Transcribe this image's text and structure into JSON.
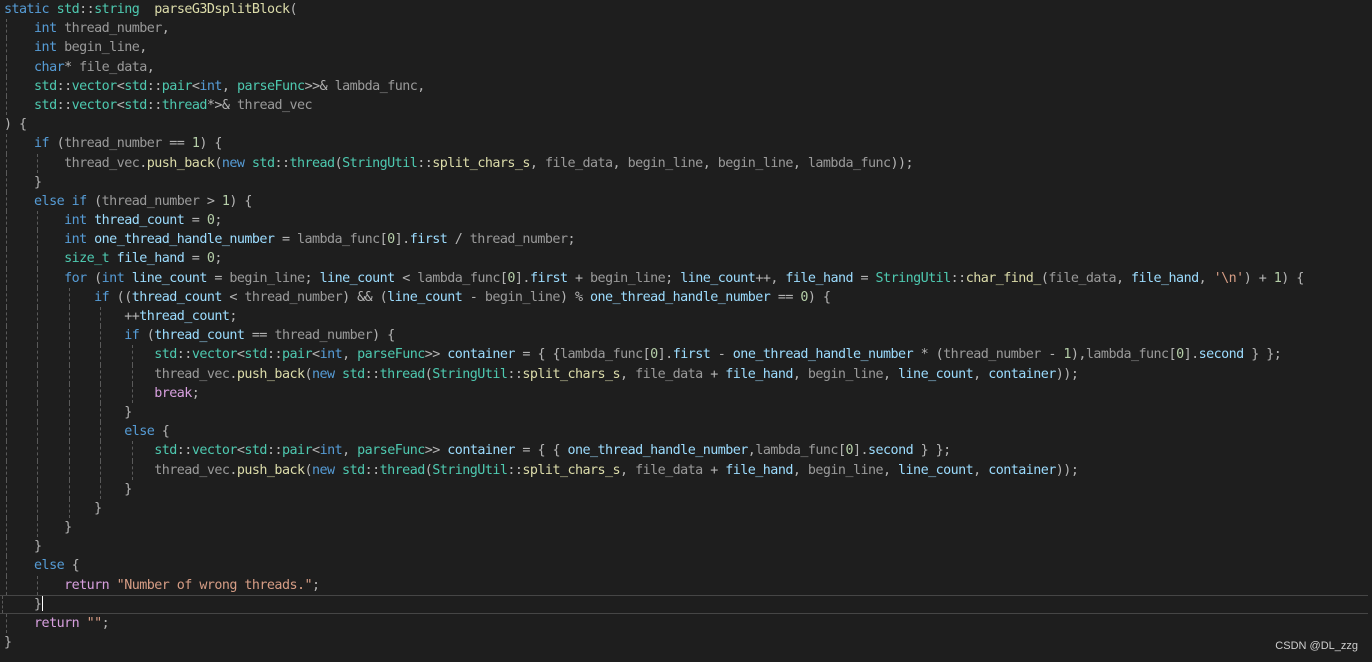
{
  "editor": {
    "theme": {
      "background": "#1e1e1e",
      "keyword": "#569cd6",
      "type": "#4ec9b0",
      "function": "#dcdcaa",
      "parameter": "#9a9a9a",
      "string": "#d69d85"
    },
    "cursor_line": 32
  },
  "code_lines": [
    [
      [
        "k",
        "static"
      ],
      [
        "",
        ""
      ],
      [
        "t",
        " std"
      ],
      [
        "o",
        "::"
      ],
      [
        "t",
        "string"
      ],
      [
        "",
        "  "
      ],
      [
        "f",
        "parseG3DsplitBlock"
      ],
      [
        "o",
        "("
      ]
    ],
    [
      [
        "",
        ""
      ],
      [
        "k",
        "    int"
      ],
      [
        "p",
        " thread_number"
      ],
      [
        "o",
        ","
      ]
    ],
    [
      [
        "k",
        "    int"
      ],
      [
        "p",
        " begin_line"
      ],
      [
        "o",
        ","
      ]
    ],
    [
      [
        "k",
        "    char"
      ],
      [
        "o",
        "*"
      ],
      [
        "p",
        " file_data"
      ],
      [
        "o",
        ","
      ]
    ],
    [
      [
        "t",
        "    std"
      ],
      [
        "o",
        "::"
      ],
      [
        "t",
        "vector"
      ],
      [
        "o",
        "<"
      ],
      [
        "t",
        "std"
      ],
      [
        "o",
        "::"
      ],
      [
        "t",
        "pair"
      ],
      [
        "o",
        "<"
      ],
      [
        "k",
        "int"
      ],
      [
        "o",
        ", "
      ],
      [
        "t",
        "parseFunc"
      ],
      [
        "o",
        ">>& "
      ],
      [
        "p",
        "lambda_func"
      ],
      [
        "o",
        ","
      ]
    ],
    [
      [
        "t",
        "    std"
      ],
      [
        "o",
        "::"
      ],
      [
        "t",
        "vector"
      ],
      [
        "o",
        "<"
      ],
      [
        "t",
        "std"
      ],
      [
        "o",
        "::"
      ],
      [
        "t",
        "thread"
      ],
      [
        "o",
        "*>& "
      ],
      [
        "p",
        "thread_vec"
      ]
    ],
    [
      [
        "o",
        ") {"
      ]
    ],
    [
      [
        "k",
        "    if"
      ],
      [
        "o",
        " ("
      ],
      [
        "p",
        "thread_number"
      ],
      [
        "o",
        " == "
      ],
      [
        "n",
        "1"
      ],
      [
        "o",
        ") {"
      ]
    ],
    [
      [
        "p",
        "        thread_vec"
      ],
      [
        "o",
        "."
      ],
      [
        "f",
        "push_back"
      ],
      [
        "o",
        "("
      ],
      [
        "k",
        "new"
      ],
      [
        "t",
        " std"
      ],
      [
        "o",
        "::"
      ],
      [
        "t",
        "thread"
      ],
      [
        "o",
        "("
      ],
      [
        "t",
        "StringUtil"
      ],
      [
        "o",
        "::"
      ],
      [
        "f",
        "split_chars_s"
      ],
      [
        "o",
        ", "
      ],
      [
        "p",
        "file_data"
      ],
      [
        "o",
        ", "
      ],
      [
        "p",
        "begin_line"
      ],
      [
        "o",
        ", "
      ],
      [
        "p",
        "begin_line"
      ],
      [
        "o",
        ", "
      ],
      [
        "p",
        "lambda_func"
      ],
      [
        "o",
        "));"
      ]
    ],
    [
      [
        "o",
        "    }"
      ]
    ],
    [
      [
        "k",
        "    else if"
      ],
      [
        "o",
        " ("
      ],
      [
        "p",
        "thread_number"
      ],
      [
        "o",
        " > "
      ],
      [
        "n",
        "1"
      ],
      [
        "o",
        ") {"
      ]
    ],
    [
      [
        "k",
        "        int"
      ],
      [
        "v",
        " thread_count"
      ],
      [
        "o",
        " = "
      ],
      [
        "n",
        "0"
      ],
      [
        "o",
        ";"
      ]
    ],
    [
      [
        "k",
        "        int"
      ],
      [
        "v",
        " one_thread_handle_number"
      ],
      [
        "o",
        " = "
      ],
      [
        "p",
        "lambda_func"
      ],
      [
        "o",
        "["
      ],
      [
        "n",
        "0"
      ],
      [
        "o",
        "]."
      ],
      [
        "v",
        "first"
      ],
      [
        "o",
        " / "
      ],
      [
        "p",
        "thread_number"
      ],
      [
        "o",
        ";"
      ]
    ],
    [
      [
        "t",
        "        size_t"
      ],
      [
        "v",
        " file_hand"
      ],
      [
        "o",
        " = "
      ],
      [
        "n",
        "0"
      ],
      [
        "o",
        ";"
      ]
    ],
    [
      [
        "k",
        "        for"
      ],
      [
        "o",
        " ("
      ],
      [
        "k",
        "int"
      ],
      [
        "v",
        " line_count"
      ],
      [
        "o",
        " = "
      ],
      [
        "p",
        "begin_line"
      ],
      [
        "o",
        "; "
      ],
      [
        "v",
        "line_count"
      ],
      [
        "o",
        " < "
      ],
      [
        "p",
        "lambda_func"
      ],
      [
        "o",
        "["
      ],
      [
        "n",
        "0"
      ],
      [
        "o",
        "]."
      ],
      [
        "v",
        "first"
      ],
      [
        "o",
        " + "
      ],
      [
        "p",
        "begin_line"
      ],
      [
        "o",
        "; "
      ],
      [
        "v",
        "line_count"
      ],
      [
        "o",
        "++, "
      ],
      [
        "v",
        "file_hand"
      ],
      [
        "o",
        " = "
      ],
      [
        "t",
        "StringUtil"
      ],
      [
        "o",
        "::"
      ],
      [
        "f",
        "char_find_"
      ],
      [
        "o",
        "("
      ],
      [
        "p",
        "file_data"
      ],
      [
        "o",
        ", "
      ],
      [
        "v",
        "file_hand"
      ],
      [
        "o",
        ", "
      ],
      [
        "s",
        "'\\n'"
      ],
      [
        "o",
        ") + "
      ],
      [
        "n",
        "1"
      ],
      [
        "o",
        ") {"
      ]
    ],
    [
      [
        "k",
        "            if"
      ],
      [
        "o",
        " (("
      ],
      [
        "v",
        "thread_count"
      ],
      [
        "o",
        " < "
      ],
      [
        "p",
        "thread_number"
      ],
      [
        "o",
        ") && ("
      ],
      [
        "v",
        "line_count"
      ],
      [
        "o",
        " - "
      ],
      [
        "p",
        "begin_line"
      ],
      [
        "o",
        ") % "
      ],
      [
        "v",
        "one_thread_handle_number"
      ],
      [
        "o",
        " == "
      ],
      [
        "n",
        "0"
      ],
      [
        "o",
        ") {"
      ]
    ],
    [
      [
        "o",
        "                ++"
      ],
      [
        "v",
        "thread_count"
      ],
      [
        "o",
        ";"
      ]
    ],
    [
      [
        "k",
        "                if"
      ],
      [
        "o",
        " ("
      ],
      [
        "v",
        "thread_count"
      ],
      [
        "o",
        " == "
      ],
      [
        "p",
        "thread_number"
      ],
      [
        "o",
        ") {"
      ]
    ],
    [
      [
        "t",
        "                    std"
      ],
      [
        "o",
        "::"
      ],
      [
        "t",
        "vector"
      ],
      [
        "o",
        "<"
      ],
      [
        "t",
        "std"
      ],
      [
        "o",
        "::"
      ],
      [
        "t",
        "pair"
      ],
      [
        "o",
        "<"
      ],
      [
        "k",
        "int"
      ],
      [
        "o",
        ", "
      ],
      [
        "t",
        "parseFunc"
      ],
      [
        "o",
        ">> "
      ],
      [
        "v",
        "container"
      ],
      [
        "o",
        " = { {"
      ],
      [
        "p",
        "lambda_func"
      ],
      [
        "o",
        "["
      ],
      [
        "n",
        "0"
      ],
      [
        "o",
        "]."
      ],
      [
        "v",
        "first"
      ],
      [
        "o",
        " - "
      ],
      [
        "v",
        "one_thread_handle_number"
      ],
      [
        "o",
        " * ("
      ],
      [
        "p",
        "thread_number"
      ],
      [
        "o",
        " - "
      ],
      [
        "n",
        "1"
      ],
      [
        "o",
        "),"
      ],
      [
        "p",
        "lambda_func"
      ],
      [
        "o",
        "["
      ],
      [
        "n",
        "0"
      ],
      [
        "o",
        "]."
      ],
      [
        "v",
        "second"
      ],
      [
        "o",
        " } };"
      ]
    ],
    [
      [
        "p",
        "                    thread_vec"
      ],
      [
        "o",
        "."
      ],
      [
        "f",
        "push_back"
      ],
      [
        "o",
        "("
      ],
      [
        "k",
        "new"
      ],
      [
        "t",
        " std"
      ],
      [
        "o",
        "::"
      ],
      [
        "t",
        "thread"
      ],
      [
        "o",
        "("
      ],
      [
        "t",
        "StringUtil"
      ],
      [
        "o",
        "::"
      ],
      [
        "f",
        "split_chars_s"
      ],
      [
        "o",
        ", "
      ],
      [
        "p",
        "file_data"
      ],
      [
        "o",
        " + "
      ],
      [
        "v",
        "file_hand"
      ],
      [
        "o",
        ", "
      ],
      [
        "p",
        "begin_line"
      ],
      [
        "o",
        ", "
      ],
      [
        "v",
        "line_count"
      ],
      [
        "o",
        ", "
      ],
      [
        "v",
        "container"
      ],
      [
        "o",
        "));"
      ]
    ],
    [
      [
        "c",
        "                    break"
      ],
      [
        "o",
        ";"
      ]
    ],
    [
      [
        "o",
        "                }"
      ]
    ],
    [
      [
        "k",
        "                else"
      ],
      [
        "o",
        " {"
      ]
    ],
    [
      [
        "t",
        "                    std"
      ],
      [
        "o",
        "::"
      ],
      [
        "t",
        "vector"
      ],
      [
        "o",
        "<"
      ],
      [
        "t",
        "std"
      ],
      [
        "o",
        "::"
      ],
      [
        "t",
        "pair"
      ],
      [
        "o",
        "<"
      ],
      [
        "k",
        "int"
      ],
      [
        "o",
        ", "
      ],
      [
        "t",
        "parseFunc"
      ],
      [
        "o",
        ">> "
      ],
      [
        "v",
        "container"
      ],
      [
        "o",
        " = { { "
      ],
      [
        "v",
        "one_thread_handle_number"
      ],
      [
        "o",
        ","
      ],
      [
        "p",
        "lambda_func"
      ],
      [
        "o",
        "["
      ],
      [
        "n",
        "0"
      ],
      [
        "o",
        "]."
      ],
      [
        "v",
        "second"
      ],
      [
        "o",
        " } };"
      ]
    ],
    [
      [
        "p",
        "                    thread_vec"
      ],
      [
        "o",
        "."
      ],
      [
        "f",
        "push_back"
      ],
      [
        "o",
        "("
      ],
      [
        "k",
        "new"
      ],
      [
        "t",
        " std"
      ],
      [
        "o",
        "::"
      ],
      [
        "t",
        "thread"
      ],
      [
        "o",
        "("
      ],
      [
        "t",
        "StringUtil"
      ],
      [
        "o",
        "::"
      ],
      [
        "f",
        "split_chars_s"
      ],
      [
        "o",
        ", "
      ],
      [
        "p",
        "file_data"
      ],
      [
        "o",
        " + "
      ],
      [
        "v",
        "file_hand"
      ],
      [
        "o",
        ", "
      ],
      [
        "p",
        "begin_line"
      ],
      [
        "o",
        ", "
      ],
      [
        "v",
        "line_count"
      ],
      [
        "o",
        ", "
      ],
      [
        "v",
        "container"
      ],
      [
        "o",
        "));"
      ]
    ],
    [
      [
        "o",
        "                }"
      ]
    ],
    [
      [
        "o",
        "            }"
      ]
    ],
    [
      [
        "o",
        "        }"
      ]
    ],
    [
      [
        "o",
        "    }"
      ]
    ],
    [
      [
        "k",
        "    else"
      ],
      [
        "o",
        " {"
      ]
    ],
    [
      [
        "c",
        "        return"
      ],
      [
        "s",
        " \"Number of wrong threads.\""
      ],
      [
        "o",
        ";"
      ]
    ],
    [
      [
        "o",
        "    }"
      ]
    ],
    [
      [
        "c",
        "    return"
      ],
      [
        "s",
        " \"\""
      ],
      [
        "o",
        ";"
      ]
    ],
    [
      [
        "o",
        "}"
      ]
    ]
  ],
  "guides": [
    [],
    [
      0
    ],
    [
      0
    ],
    [
      0
    ],
    [
      0
    ],
    [
      0
    ],
    [],
    [
      0
    ],
    [
      0,
      1
    ],
    [
      0
    ],
    [
      0
    ],
    [
      0,
      1
    ],
    [
      0,
      1
    ],
    [
      0,
      1
    ],
    [
      0,
      1
    ],
    [
      0,
      1,
      2
    ],
    [
      0,
      1,
      2,
      3
    ],
    [
      0,
      1,
      2,
      3
    ],
    [
      0,
      1,
      2,
      3,
      4
    ],
    [
      0,
      1,
      2,
      3,
      4
    ],
    [
      0,
      1,
      2,
      3,
      4
    ],
    [
      0,
      1,
      2,
      3
    ],
    [
      0,
      1,
      2,
      3
    ],
    [
      0,
      1,
      2,
      3,
      4
    ],
    [
      0,
      1,
      2,
      3,
      4
    ],
    [
      0,
      1,
      2,
      3
    ],
    [
      0,
      1,
      2
    ],
    [
      0,
      1
    ],
    [
      0
    ],
    [
      0
    ],
    [
      0,
      1
    ],
    [
      0
    ],
    [
      0
    ],
    []
  ],
  "watermark": "CSDN @DL_zzg"
}
